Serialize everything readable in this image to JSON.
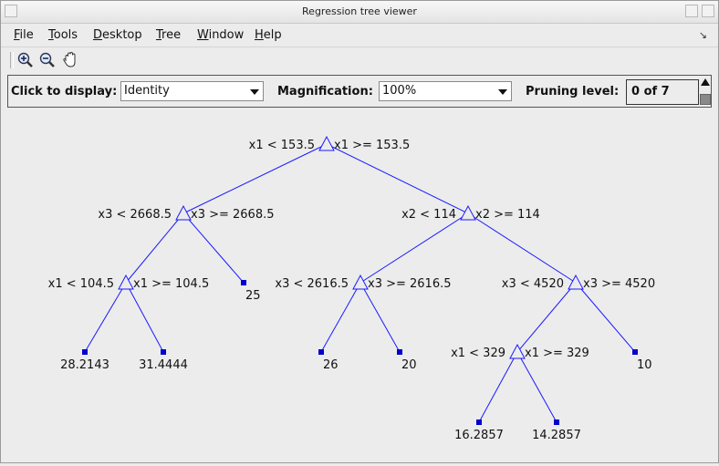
{
  "window": {
    "title": "Regression tree viewer"
  },
  "menu": [
    {
      "label": "File",
      "mnemonic": "F",
      "rest": "ile"
    },
    {
      "label": "Tools",
      "mnemonic": "T",
      "rest": "ools"
    },
    {
      "label": "Desktop",
      "mnemonic": "D",
      "rest": "esktop"
    },
    {
      "label": "Tree",
      "mnemonic": "T",
      "rest": "ree"
    },
    {
      "label": "Window",
      "mnemonic": "W",
      "rest": "indow"
    },
    {
      "label": "Help",
      "mnemonic": "H",
      "rest": "elp"
    }
  ],
  "toolbar": {
    "icons": [
      "zoom-in-icon",
      "zoom-out-icon",
      "pan-hand-icon"
    ]
  },
  "controls": {
    "display_label": "Click to display:",
    "display_value": "Identity",
    "magnification_label": "Magnification:",
    "magnification_value": "100%",
    "pruning_label": "Pruning level:",
    "pruning_value": "0 of 7"
  },
  "tree": {
    "line_color": "#1a1aff",
    "node_color": "#0000cc",
    "branch_nodes": [
      {
        "id": "n1",
        "left": "x1 < 153.5",
        "right": "x1 >= 153.5"
      },
      {
        "id": "n2",
        "left": "x3 < 2668.5",
        "right": "x3 >= 2668.5"
      },
      {
        "id": "n3",
        "left": "x2 < 114",
        "right": "x2 >= 114"
      },
      {
        "id": "n4",
        "left": "x1 < 104.5",
        "right": "x1 >= 104.5"
      },
      {
        "id": "n6",
        "left": "x3 < 2616.5",
        "right": "x3 >= 2616.5"
      },
      {
        "id": "n7",
        "left": "x3 < 4520",
        "right": "x3 >= 4520"
      },
      {
        "id": "n12",
        "left": "x1 < 329",
        "right": "x1 >= 329"
      }
    ],
    "leaf_nodes": [
      {
        "id": "l1",
        "value": "28.2143"
      },
      {
        "id": "l2",
        "value": "31.4444"
      },
      {
        "id": "l3",
        "value": "25"
      },
      {
        "id": "l4",
        "value": "26"
      },
      {
        "id": "l5",
        "value": "20"
      },
      {
        "id": "l6",
        "value": "10"
      },
      {
        "id": "l7",
        "value": "16.2857"
      },
      {
        "id": "l8",
        "value": "14.2857"
      }
    ]
  }
}
